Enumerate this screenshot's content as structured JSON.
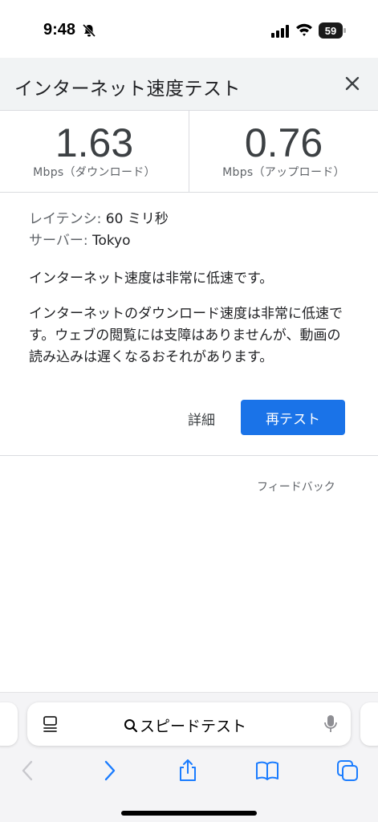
{
  "status_bar": {
    "time": "9:48",
    "battery": "59"
  },
  "speedtest": {
    "title": "インターネット速度テスト",
    "download": {
      "value": "1.63",
      "label": "Mbps（ダウンロード）"
    },
    "upload": {
      "value": "0.76",
      "label": "Mbps（アップロード）"
    },
    "latency_label": "レイテンシ:",
    "latency_value": "60 ミリ秒",
    "server_label": "サーバー:",
    "server_value": "Tokyo",
    "summary": "インターネット速度は非常に低速です。",
    "description": "インターネットのダウンロード速度は非常に低速です。ウェブの閲覧には支障はありませんが、動画の読み込みは遅くなるおそれがあります。",
    "details_label": "詳細",
    "retest_label": "再テスト",
    "feedback_label": "フィードバック",
    "accent_color": "#1a73e8"
  },
  "safari": {
    "search_text": "スピードテスト",
    "icons": [
      "reader-icon",
      "search-icon",
      "mic-icon",
      "back-icon",
      "forward-icon",
      "share-icon",
      "bookmarks-icon",
      "tabs-icon"
    ],
    "tint_color": "#1a7cff"
  }
}
